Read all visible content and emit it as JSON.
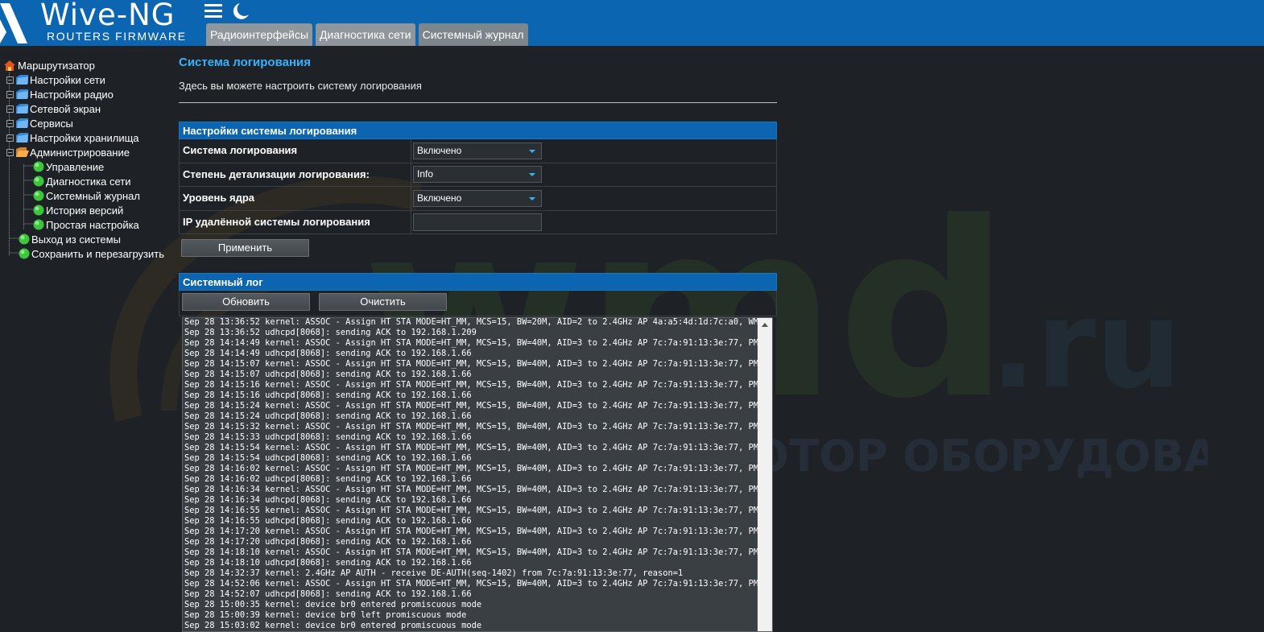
{
  "header": {
    "logo_title": "Wive-NG",
    "logo_subtitle": "ROUTERS FIRMWARE",
    "menu_icon": "hamburger-menu-icon",
    "theme_icon": "crescent-moon-icon",
    "tabs": [
      {
        "label": "Радиоинтерфейсы"
      },
      {
        "label": "Диагностика сети"
      },
      {
        "label": "Системный журнал"
      }
    ]
  },
  "sidebar": {
    "root": "Маршрутизатор",
    "items": [
      {
        "label": "Настройки сети"
      },
      {
        "label": "Настройки радио"
      },
      {
        "label": "Сетевой экран"
      },
      {
        "label": "Сервисы"
      },
      {
        "label": "Настройки хранилища"
      },
      {
        "label": "Администрирование"
      }
    ],
    "admin_children": [
      {
        "label": "Управление"
      },
      {
        "label": "Диагностика сети"
      },
      {
        "label": "Системный журнал"
      },
      {
        "label": "История версий"
      },
      {
        "label": "Простая настройка"
      }
    ],
    "bottom_items": [
      {
        "label": "Выход из системы"
      },
      {
        "label": "Сохранить и перезагрузить"
      }
    ]
  },
  "page": {
    "title": "Система логирования",
    "description": "Здесь вы можете настроить систему логирования"
  },
  "settings": {
    "heading": "Настройки системы логирования",
    "rows": [
      {
        "label": "Система логирования",
        "value": "Включено"
      },
      {
        "label": "Степень детализации логирования:",
        "value": "Info"
      },
      {
        "label": "Уровень ядра",
        "value": "Включено"
      },
      {
        "label": "IP удалённой системы логирования",
        "value": ""
      }
    ],
    "apply_label": "Применить"
  },
  "syslog": {
    "heading": "Системный лог",
    "refresh_label": "Обновить",
    "clear_label": "Очистить",
    "text": "Sep 28 13:36:52 kernel: ASSOC - Assign HT STA MODE=HT_MM, MCS=15, BW=20M, AID=2 to 2.4GHz AP 4a:a5:4d:1d:7c:a0, WMM suppor\nSep 28 13:36:52 udhcpd[8068]: sending ACK to 192.168.1.209\nSep 28 14:14:49 kernel: ASSOC - Assign HT STA MODE=HT_MM, MCS=15, BW=40M, AID=3 to 2.4GHz AP 7c:7a:91:13:3e:77, PMF connec\nSep 28 14:14:49 udhcpd[8068]: sending ACK to 192.168.1.66\nSep 28 14:15:07 kernel: ASSOC - Assign HT STA MODE=HT_MM, MCS=15, BW=40M, AID=3 to 2.4GHz AP 7c:7a:91:13:3e:77, PMF connec\nSep 28 14:15:07 udhcpd[8068]: sending ACK to 192.168.1.66\nSep 28 14:15:16 kernel: ASSOC - Assign HT STA MODE=HT_MM, MCS=15, BW=40M, AID=3 to 2.4GHz AP 7c:7a:91:13:3e:77, PMF connec\nSep 28 14:15:16 udhcpd[8068]: sending ACK to 192.168.1.66\nSep 28 14:15:24 kernel: ASSOC - Assign HT STA MODE=HT_MM, MCS=15, BW=40M, AID=3 to 2.4GHz AP 7c:7a:91:13:3e:77, PMF connec\nSep 28 14:15:24 udhcpd[8068]: sending ACK to 192.168.1.66\nSep 28 14:15:32 kernel: ASSOC - Assign HT STA MODE=HT_MM, MCS=15, BW=40M, AID=3 to 2.4GHz AP 7c:7a:91:13:3e:77, PMF connec\nSep 28 14:15:33 udhcpd[8068]: sending ACK to 192.168.1.66\nSep 28 14:15:54 kernel: ASSOC - Assign HT STA MODE=HT_MM, MCS=15, BW=40M, AID=3 to 2.4GHz AP 7c:7a:91:13:3e:77, PMF connec\nSep 28 14:15:54 udhcpd[8068]: sending ACK to 192.168.1.66\nSep 28 14:16:02 kernel: ASSOC - Assign HT STA MODE=HT_MM, MCS=15, BW=40M, AID=3 to 2.4GHz AP 7c:7a:91:13:3e:77, PMF connec\nSep 28 14:16:02 udhcpd[8068]: sending ACK to 192.168.1.66\nSep 28 14:16:34 kernel: ASSOC - Assign HT STA MODE=HT_MM, MCS=15, BW=40M, AID=3 to 2.4GHz AP 7c:7a:91:13:3e:77, PMF connec\nSep 28 14:16:34 udhcpd[8068]: sending ACK to 192.168.1.66\nSep 28 14:16:55 kernel: ASSOC - Assign HT STA MODE=HT_MM, MCS=15, BW=40M, AID=3 to 2.4GHz AP 7c:7a:91:13:3e:77, PMF connec\nSep 28 14:16:55 udhcpd[8068]: sending ACK to 192.168.1.66\nSep 28 14:17:20 kernel: ASSOC - Assign HT STA MODE=HT_MM, MCS=15, BW=40M, AID=3 to 2.4GHz AP 7c:7a:91:13:3e:77, PMF connec\nSep 28 14:17:20 udhcpd[8068]: sending ACK to 192.168.1.66\nSep 28 14:18:10 kernel: ASSOC - Assign HT STA MODE=HT_MM, MCS=15, BW=40M, AID=3 to 2.4GHz AP 7c:7a:91:13:3e:77, PMF connec\nSep 28 14:18:10 udhcpd[8068]: sending ACK to 192.168.1.66\nSep 28 14:32:37 kernel: 2.4GHz AP AUTH - receive DE-AUTH(seq-1402) from 7c:7a:91:13:3e:77, reason=1\nSep 28 14:52:06 kernel: ASSOC - Assign HT STA MODE=HT_MM, MCS=15, BW=40M, AID=3 to 2.4GHz AP 7c:7a:91:13:3e:77, PMF connec\nSep 28 14:52:07 udhcpd[8068]: sending ACK to 192.168.1.66\nSep 28 15:00:35 kernel: device br0 entered promiscuous mode\nSep 28 15:00:39 kernel: device br0 left promiscuous mode\nSep 28 15:03:02 kernel: device br0 entered promiscuous mode"
  },
  "watermark": {
    "brand": "wmd.ru",
    "tagline": "ДИСТРИБЬЮТОР ОБОРУДОВАНИЯ СВЯЗИ"
  },
  "colors": {
    "header_blue": "#0b65b0",
    "title_blue": "#36b2ff",
    "background": "#1e2226"
  }
}
